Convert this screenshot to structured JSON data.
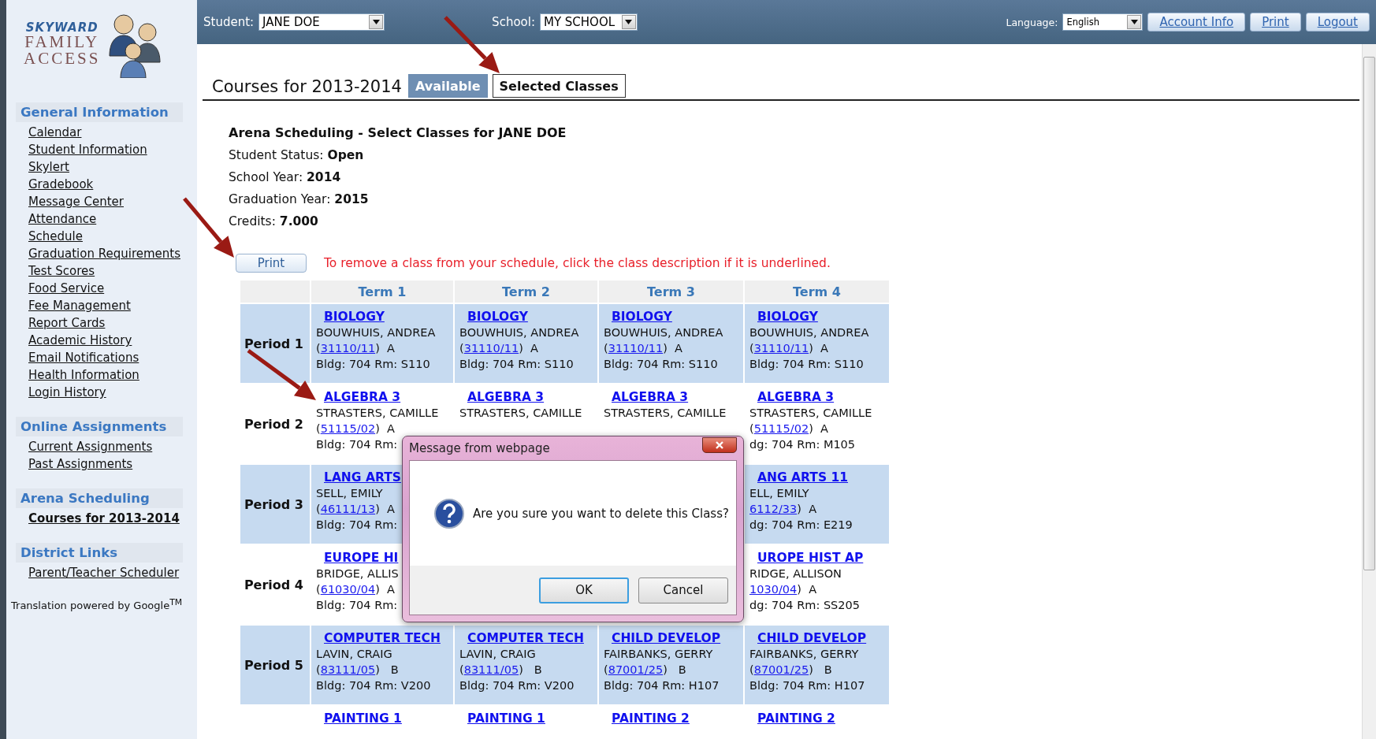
{
  "logo": {
    "lines": [
      "SKYWARD",
      "FAMILY",
      "ACCESS"
    ]
  },
  "top_bar": {
    "student_label": "Student:",
    "student": "JANE DOE",
    "school_label": "School:",
    "school": "MY SCHOOL",
    "language_label": "Language:",
    "language": "English",
    "buttons": [
      "Account Info",
      "Print",
      "Logout"
    ]
  },
  "sidebar": {
    "sections": [
      {
        "heading": "General Information",
        "items": [
          {
            "label": "Calendar",
            "selected": false
          },
          {
            "label": "Student Information",
            "selected": false
          },
          {
            "label": "Skylert",
            "selected": false
          },
          {
            "label": "Gradebook",
            "selected": false
          },
          {
            "label": "Message Center",
            "selected": false
          },
          {
            "label": "Attendance",
            "selected": false
          },
          {
            "label": "Schedule",
            "selected": false
          },
          {
            "label": "Graduation Requirements",
            "selected": false
          },
          {
            "label": "Test Scores",
            "selected": false
          },
          {
            "label": "Food Service",
            "selected": false
          },
          {
            "label": "Fee Management",
            "selected": false
          },
          {
            "label": "Report Cards",
            "selected": false
          },
          {
            "label": "Academic History",
            "selected": false
          },
          {
            "label": "Email Notifications",
            "selected": false
          },
          {
            "label": "Health Information",
            "selected": false
          },
          {
            "label": "Login History",
            "selected": false
          }
        ]
      },
      {
        "heading": "Online Assignments",
        "items": [
          {
            "label": "Current Assignments",
            "selected": false
          },
          {
            "label": "Past Assignments",
            "selected": false
          }
        ]
      },
      {
        "heading": "Arena Scheduling",
        "items": [
          {
            "label": "Courses for 2013-2014",
            "selected": true
          }
        ]
      },
      {
        "heading": "District Links",
        "items": [
          {
            "label": "Parent/Teacher Scheduler",
            "selected": false
          }
        ]
      }
    ],
    "footer": "Translation powered by Google$^{TM}$"
  },
  "page": {
    "title": "Courses for 2013-2014",
    "tabs": [
      {
        "label": "Available",
        "selected": true
      },
      {
        "label": "Selected Classes",
        "selected": false
      }
    ]
  },
  "info": {
    "heading": "Arena Scheduling - Select Classes for JANE DOE",
    "lines": [
      "Student Status: **Open**",
      "School Year: **2014**",
      "Graduation Year: **2015**",
      "Credits: **7.000**"
    ]
  },
  "print_button": "Print",
  "notice": "To remove a class from your schedule, click the class description if it is underlined.",
  "table": {
    "columns": [
      "Term 1",
      "Term 2",
      "Term 3",
      "Term 4"
    ],
    "rows": [
      {
        "period": "Period 1",
        "cells": [
          {
            "course": "BIOLOGY",
            "teacher": "BOUWHUIS, ANDREA",
            "code": {
              "before": "(",
              "link": "31110/11",
              "after": ")  A"
            },
            "room": "Bldg: 704 Rm: S110"
          },
          {
            "course": "BIOLOGY",
            "teacher": "BOUWHUIS, ANDREA",
            "code": {
              "before": "(",
              "link": "31110/11",
              "after": ")  A"
            },
            "room": "Bldg: 704 Rm: S110"
          },
          {
            "course": "BIOLOGY",
            "teacher": "BOUWHUIS, ANDREA",
            "code": {
              "before": "(",
              "link": "31110/11",
              "after": ")  A"
            },
            "room": "Bldg: 704 Rm: S110"
          },
          {
            "course": "BIOLOGY",
            "teacher": "BOUWHUIS, ANDREA",
            "code": {
              "before": "(",
              "link": "31110/11",
              "after": ")  A"
            },
            "room": "Bldg: 704 Rm: S110"
          }
        ]
      },
      {
        "period": "Period 2",
        "cells": [
          {
            "course": "ALGEBRA 3",
            "teacher": "STRASTERS, CAMILLE",
            "code": {
              "before": "(",
              "link": "51115/02",
              "after": ")  A"
            },
            "room": "Bldg: 704 Rm:"
          },
          {
            "course": "ALGEBRA 3",
            "teacher": "STRASTERS, CAMILLE"
          },
          {
            "course": "ALGEBRA 3",
            "teacher": "STRASTERS, CAMILLE"
          },
          {
            "course": "ALGEBRA 3",
            "teacher": "STRASTERS, CAMILLE",
            "code": {
              "before": "(",
              "link": "51115/02",
              "after": ")  A"
            },
            "room": "dg: 704 Rm: M105"
          }
        ]
      },
      {
        "period": "Period 3",
        "cells": [
          {
            "course": "LANG ARTS",
            "teacher": "SELL, EMILY",
            "code": {
              "before": "(",
              "link": "46111/13",
              "after": ")  A"
            },
            "room": "Bldg: 704 Rm:"
          },
          {},
          {},
          {
            "course": "ANG ARTS 11",
            "teacher": "ELL, EMILY",
            "code": {
              "link": "6112/33",
              "after": ")  A"
            },
            "room": "dg: 704 Rm: E219"
          }
        ]
      },
      {
        "period": "Period 4",
        "cells": [
          {
            "course": "EUROPE HI",
            "teacher": "BRIDGE, ALLIS",
            "code": {
              "before": "(",
              "link": "61030/04",
              "after": ")  A"
            },
            "room": "Bldg: 704 Rm:"
          },
          {},
          {},
          {
            "course": "UROPE HIST AP",
            "teacher": "RIDGE, ALLISON",
            "code": {
              "link": "1030/04",
              "after": ")  A"
            },
            "room": "dg: 704 Rm: SS205"
          }
        ]
      },
      {
        "period": "Period 5",
        "cells": [
          {
            "course": "COMPUTER TECH",
            "teacher": "LAVIN, CRAIG",
            "code": {
              "before": "(",
              "link": "83111/05",
              "after": ")   B"
            },
            "room": "Bldg: 704 Rm: V200"
          },
          {
            "course": "COMPUTER TECH",
            "teacher": "LAVIN, CRAIG",
            "code": {
              "before": "(",
              "link": "83111/05",
              "after": ")   B"
            },
            "room": "Bldg: 704 Rm: V200"
          },
          {
            "course": "CHILD DEVELOP",
            "teacher": "FAIRBANKS, GERRY",
            "code": {
              "before": "(",
              "link": "87001/25",
              "after": ")   B"
            },
            "room": "Bldg: 704 Rm: H107"
          },
          {
            "course": "CHILD DEVELOP",
            "teacher": "FAIRBANKS, GERRY",
            "code": {
              "before": "(",
              "link": "87001/25",
              "after": ")   B"
            },
            "room": "Bldg: 704 Rm: H107"
          }
        ]
      },
      {
        "cells": [
          {
            "course": "PAINTING 1"
          },
          {
            "course": "PAINTING 1"
          },
          {
            "course": "PAINTING 2"
          },
          {
            "course": "PAINTING 2"
          }
        ]
      }
    ]
  },
  "dialog": {
    "title": "Message from webpage",
    "message": "Are you sure you want to delete this Class?",
    "buttons": [
      {
        "label": "OK",
        "default": true
      },
      {
        "label": "Cancel",
        "default": false
      }
    ]
  }
}
